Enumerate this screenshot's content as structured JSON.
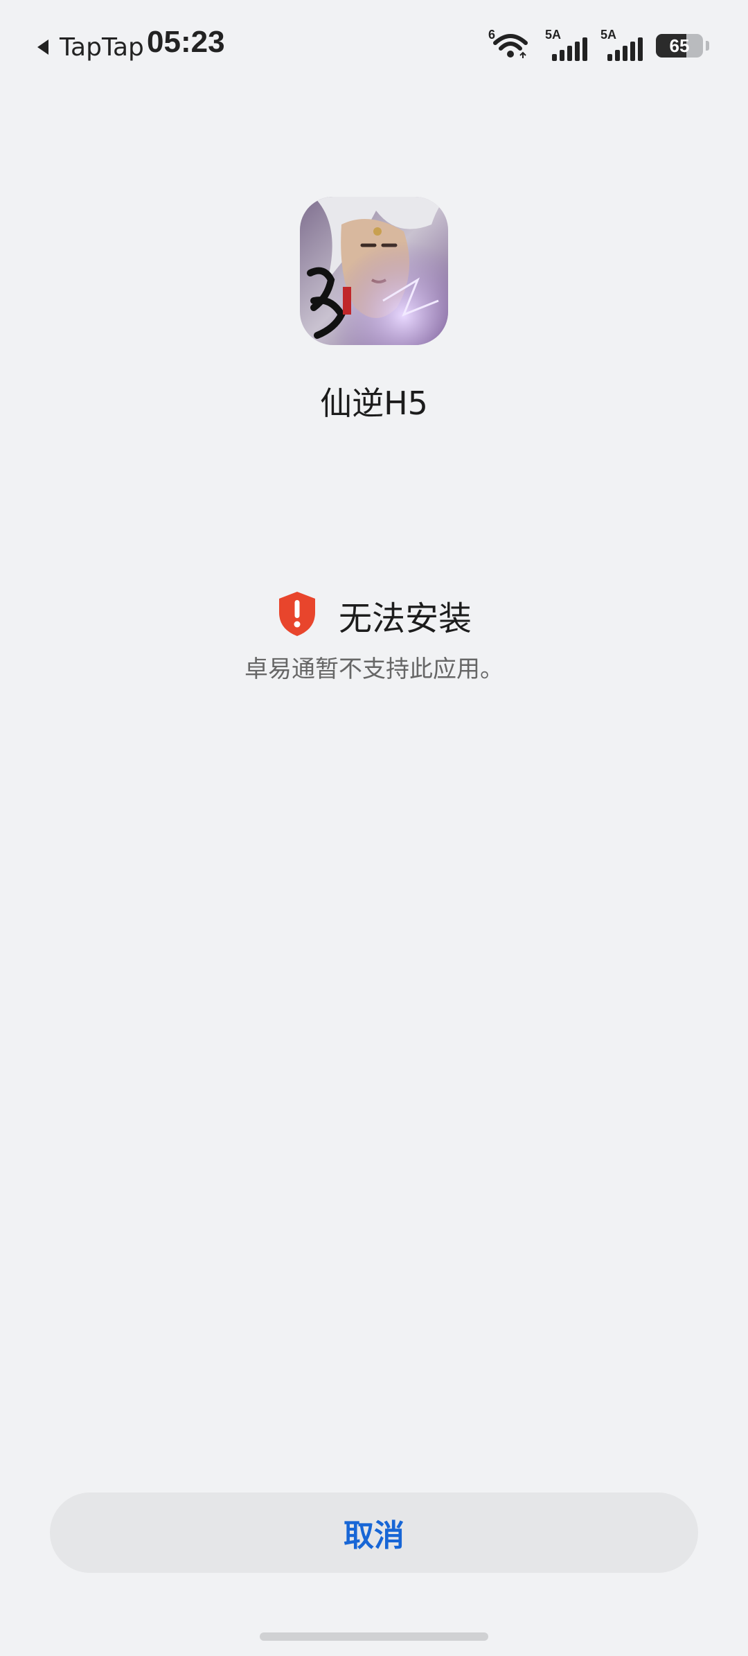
{
  "status_bar": {
    "back_app": "TapTap",
    "time": "05:23",
    "wifi_tag": "6",
    "signal1_tag": "5A",
    "signal2_tag": "5A",
    "battery_level": "65"
  },
  "app": {
    "name": "仙逆H5",
    "icon": "app-icon-xianni"
  },
  "error": {
    "title": "无法安装",
    "message": "卓易通暂不支持此应用。",
    "icon": "shield-alert-icon",
    "color": "#E8452C"
  },
  "actions": {
    "cancel_label": "取消",
    "accent": "#1766D6"
  }
}
